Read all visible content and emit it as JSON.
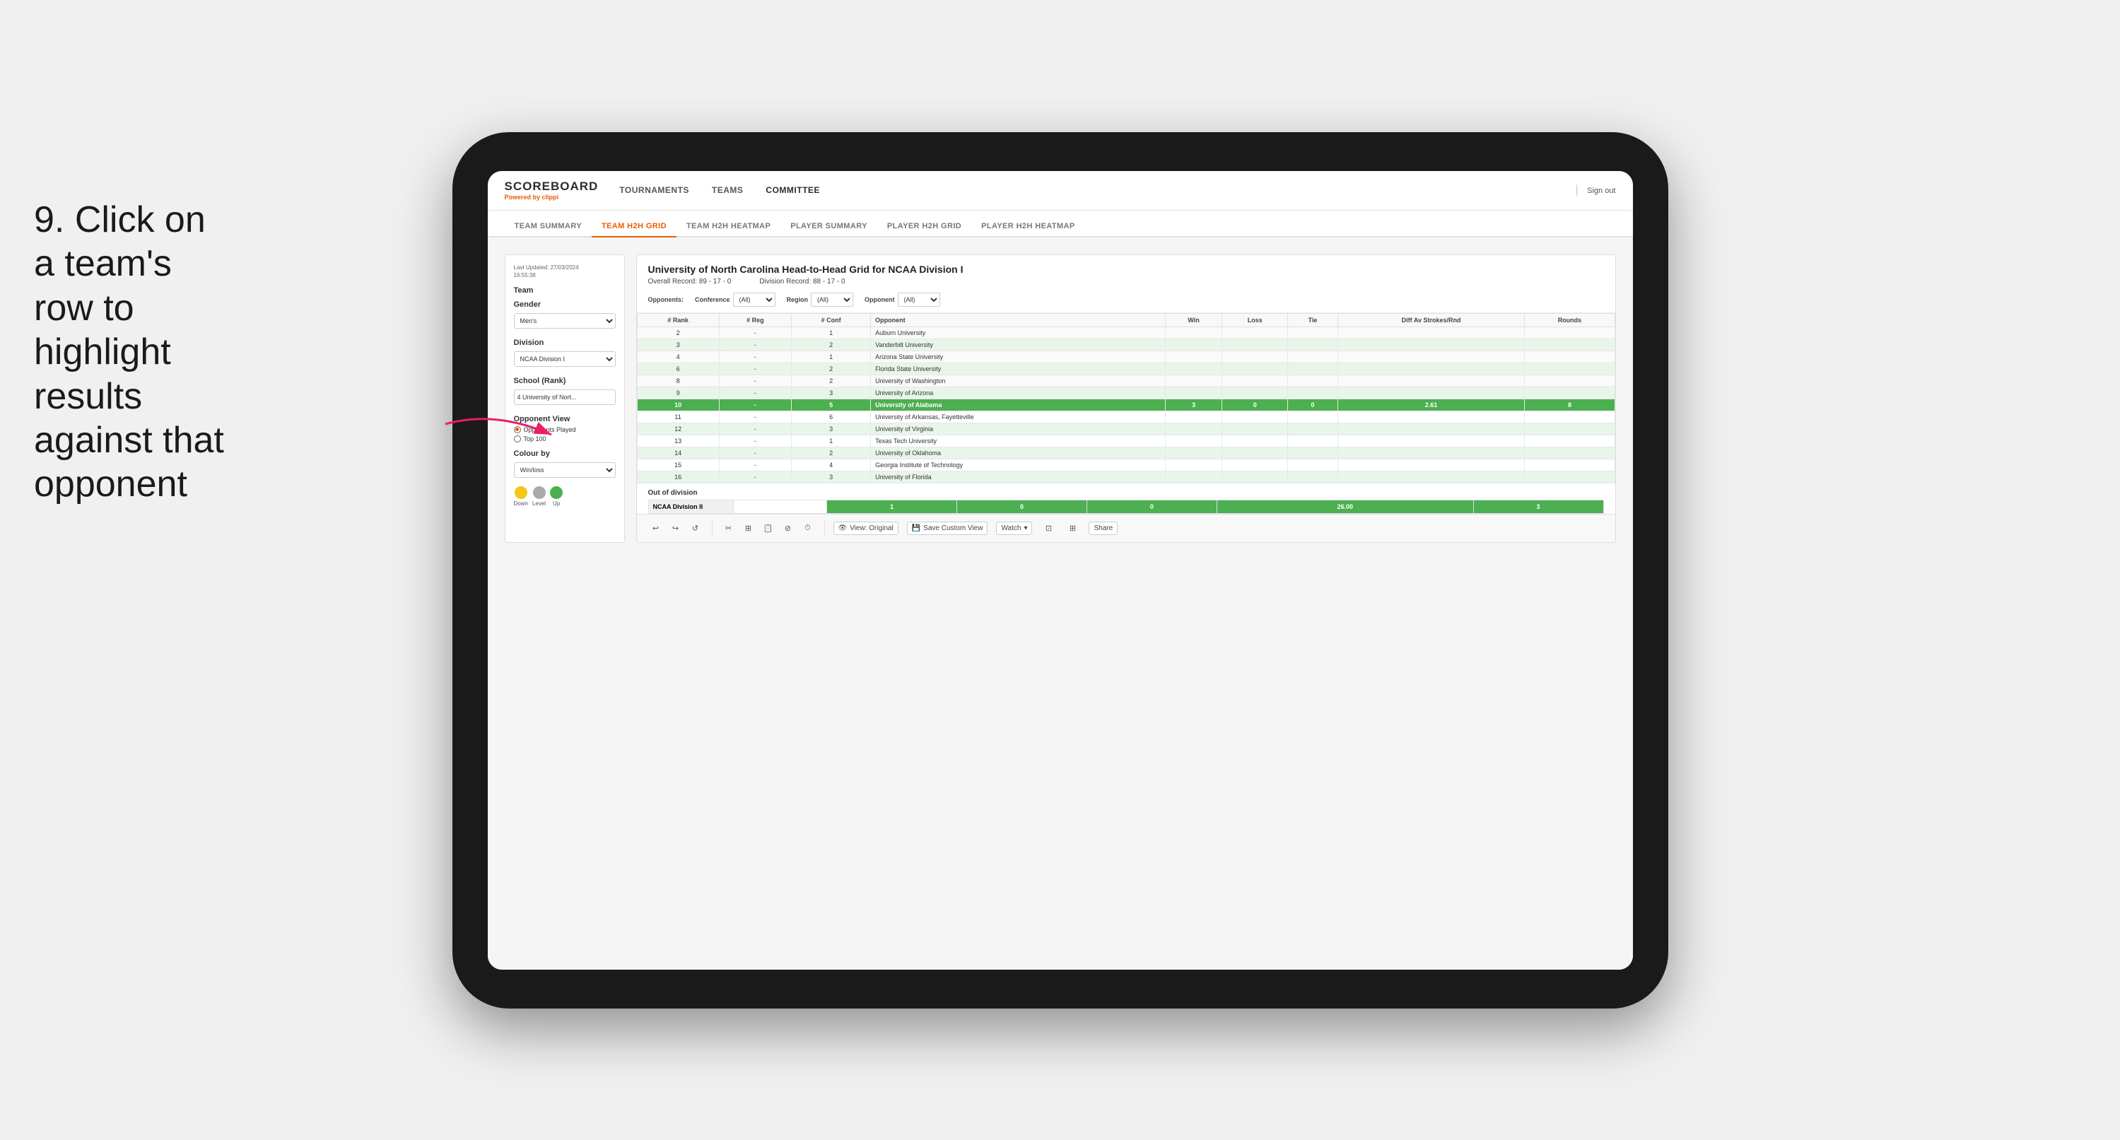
{
  "instruction": {
    "number": "9.",
    "text": "Click on a team's row to highlight results against that opponent"
  },
  "nav": {
    "logo": "SCOREBOARD",
    "powered_by": "Powered by",
    "brand": "clippi",
    "items": [
      "TOURNAMENTS",
      "TEAMS",
      "COMMITTEE"
    ],
    "sign_out": "Sign out"
  },
  "sub_nav": {
    "items": [
      "TEAM SUMMARY",
      "TEAM H2H GRID",
      "TEAM H2H HEATMAP",
      "PLAYER SUMMARY",
      "PLAYER H2H GRID",
      "PLAYER H2H HEATMAP"
    ],
    "active": "TEAM H2H GRID"
  },
  "left_panel": {
    "last_updated_label": "Last Updated: 27/03/2024",
    "last_updated_time": "16:55:38",
    "team_label": "Team",
    "gender_label": "Gender",
    "gender_value": "Men's",
    "division_label": "Division",
    "division_value": "NCAA Division I",
    "school_rank_label": "School (Rank)",
    "school_rank_value": "4 University of Nort...",
    "opponent_view_label": "Opponent View",
    "opponents_played": "Opponents Played",
    "top100": "Top 100",
    "colour_by_label": "Colour by",
    "colour_by_value": "Win/loss",
    "legend": {
      "down_label": "Down",
      "level_label": "Level",
      "up_label": "Up"
    }
  },
  "grid": {
    "title": "University of North Carolina Head-to-Head Grid for NCAA Division I",
    "overall_record_label": "Overall Record:",
    "overall_record": "89 - 17 - 0",
    "division_record_label": "Division Record:",
    "division_record": "88 - 17 - 0",
    "filter_opponents_label": "Opponents:",
    "filter_conference_label": "Conference",
    "filter_region_label": "Region",
    "filter_opponent_label": "Opponent",
    "filter_all": "(All)",
    "columns": {
      "rank": "# Rank",
      "reg": "# Reg",
      "conf": "# Conf",
      "opponent": "Opponent",
      "win": "Win",
      "loss": "Loss",
      "tie": "Tie",
      "diff_av_strokes": "Diff Av Strokes/Rnd",
      "rounds": "Rounds"
    },
    "rows": [
      {
        "rank": "2",
        "reg": "-",
        "conf": "1",
        "opponent": "Auburn University",
        "win": "",
        "loss": "",
        "tie": "",
        "diff": "",
        "rounds": "",
        "style": "normal"
      },
      {
        "rank": "3",
        "reg": "-",
        "conf": "2",
        "opponent": "Vanderbilt University",
        "win": "",
        "loss": "",
        "tie": "",
        "diff": "",
        "rounds": "",
        "style": "light-green"
      },
      {
        "rank": "4",
        "reg": "-",
        "conf": "1",
        "opponent": "Arizona State University",
        "win": "",
        "loss": "",
        "tie": "",
        "diff": "",
        "rounds": "",
        "style": "normal"
      },
      {
        "rank": "6",
        "reg": "-",
        "conf": "2",
        "opponent": "Florida State University",
        "win": "",
        "loss": "",
        "tie": "",
        "diff": "",
        "rounds": "",
        "style": "light-green"
      },
      {
        "rank": "8",
        "reg": "-",
        "conf": "2",
        "opponent": "University of Washington",
        "win": "",
        "loss": "",
        "tie": "",
        "diff": "",
        "rounds": "",
        "style": "normal"
      },
      {
        "rank": "9",
        "reg": "-",
        "conf": "3",
        "opponent": "University of Arizona",
        "win": "",
        "loss": "",
        "tie": "",
        "diff": "",
        "rounds": "",
        "style": "light-green"
      },
      {
        "rank": "10",
        "reg": "-",
        "conf": "5",
        "opponent": "University of Alabama",
        "win": "3",
        "loss": "0",
        "tie": "0",
        "diff": "2.61",
        "rounds": "8",
        "style": "highlighted"
      },
      {
        "rank": "11",
        "reg": "-",
        "conf": "6",
        "opponent": "University of Arkansas, Fayetteville",
        "win": "",
        "loss": "",
        "tie": "",
        "diff": "",
        "rounds": "",
        "style": "normal"
      },
      {
        "rank": "12",
        "reg": "-",
        "conf": "3",
        "opponent": "University of Virginia",
        "win": "",
        "loss": "",
        "tie": "",
        "diff": "",
        "rounds": "",
        "style": "light-green"
      },
      {
        "rank": "13",
        "reg": "-",
        "conf": "1",
        "opponent": "Texas Tech University",
        "win": "",
        "loss": "",
        "tie": "",
        "diff": "",
        "rounds": "",
        "style": "normal"
      },
      {
        "rank": "14",
        "reg": "-",
        "conf": "2",
        "opponent": "University of Oklahoma",
        "win": "",
        "loss": "",
        "tie": "",
        "diff": "",
        "rounds": "",
        "style": "light-green"
      },
      {
        "rank": "15",
        "reg": "-",
        "conf": "4",
        "opponent": "Georgia Institute of Technology",
        "win": "",
        "loss": "",
        "tie": "",
        "diff": "",
        "rounds": "",
        "style": "normal"
      },
      {
        "rank": "16",
        "reg": "-",
        "conf": "3",
        "opponent": "University of Florida",
        "win": "",
        "loss": "",
        "tie": "",
        "diff": "",
        "rounds": "",
        "style": "light-green"
      }
    ],
    "out_of_division_label": "Out of division",
    "out_of_division_row": {
      "name": "NCAA Division II",
      "win": "1",
      "loss": "0",
      "tie": "0",
      "diff": "26.00",
      "rounds": "3"
    }
  },
  "toolbar": {
    "undo": "↩",
    "redo": "↪",
    "revert": "↺",
    "view_original": "View: Original",
    "save_custom": "Save Custom View",
    "watch": "Watch",
    "share": "Share"
  }
}
